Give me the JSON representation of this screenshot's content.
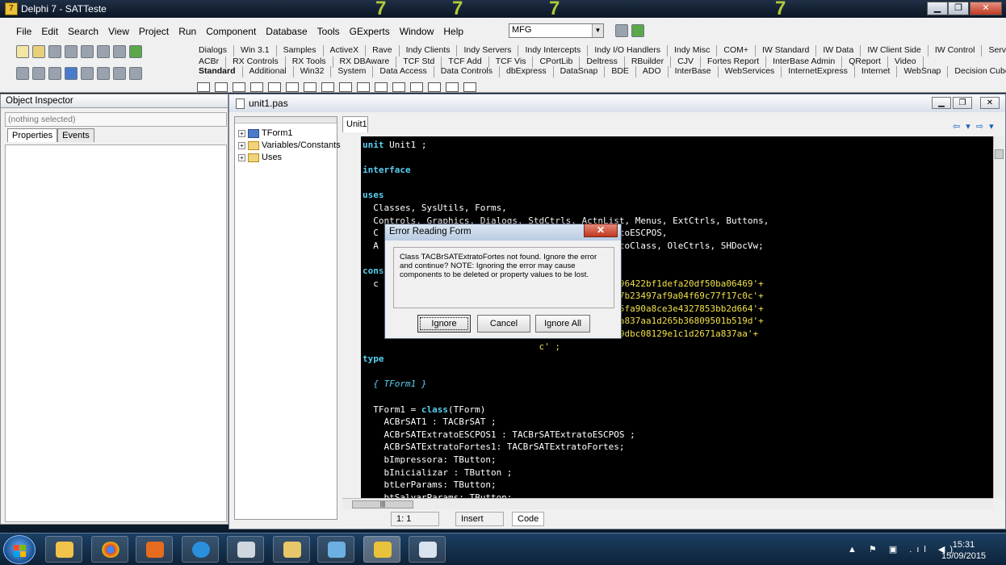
{
  "window": {
    "title": "Delphi 7 - SATTeste",
    "min": "▁",
    "max": "❐",
    "close": "✕"
  },
  "menu": [
    "File",
    "Edit",
    "Search",
    "View",
    "Project",
    "Run",
    "Component",
    "Database",
    "Tools",
    "GExperts",
    "Window",
    "Help"
  ],
  "desktop_combo": {
    "value": "MFG"
  },
  "palette": {
    "row1": [
      "Dialogs",
      "Win 3.1",
      "Samples",
      "ActiveX",
      "Rave",
      "Indy Clients",
      "Indy Servers",
      "Indy Intercepts",
      "Indy I/O Handlers",
      "Indy Misc",
      "COM+",
      "IW Standard",
      "IW Data",
      "IW Client Side",
      "IW Control",
      "Servers"
    ],
    "row2": [
      "ACBr",
      "RX Controls",
      "RX Tools",
      "RX DBAware",
      "TCF Std",
      "TCF Add",
      "TCF Vis",
      "CPortLib",
      "Deltress",
      "RBuilder",
      "CJV",
      "Fortes Report",
      "InterBase Admin",
      "QReport",
      "Video"
    ],
    "row3": [
      "Standard",
      "Additional",
      "Win32",
      "System",
      "Data Access",
      "Data Controls",
      "dbExpress",
      "DataSnap",
      "BDE",
      "ADO",
      "InterBase",
      "WebServices",
      "InternetExpress",
      "Internet",
      "WebSnap",
      "Decision Cube"
    ]
  },
  "object_inspector": {
    "title": "Object Inspector",
    "selection": "(nothing selected)",
    "tabs": [
      "Properties",
      "Events"
    ]
  },
  "editor": {
    "title": "unit1.pas",
    "tab": "Unit1",
    "tree": [
      "TForm1",
      "Variables/Constants",
      "Uses"
    ],
    "nav": "⇦ ▾ ⇨ ▾",
    "code": [
      [
        {
          "t": "unit ",
          "c": "kw"
        },
        {
          "t": "Unit1 ;",
          "c": "ident"
        }
      ],
      [],
      [
        {
          "t": "interface",
          "c": "kw"
        }
      ],
      [],
      [
        {
          "t": "uses",
          "c": "kw"
        }
      ],
      [
        {
          "t": "  Classes, SysUtils, Forms,",
          "c": "ident"
        }
      ],
      [
        {
          "t": "  Controls, Graphics, Dialogs, StdCtrls, ActnList, Menus, ExtCtrls, Buttons,",
          "c": "ident"
        }
      ],
      [
        {
          "t": "  C                                 ACBrSATExtratoESCPOS,",
          "c": "ident"
        }
      ],
      [
        {
          "t": "  A                                 ACBrSATExtratoClass, OleCtrls, SHDocVw;",
          "c": "ident"
        }
      ],
      [],
      [
        {
          "t": "cons",
          "c": "kw"
        }
      ],
      [
        {
          "t": "  c                                  ",
          "c": "ident"
        },
        {
          "t": "0719d526c5096422bf1defa20df50ba06469'+",
          "c": "hx"
        }
      ],
      [
        {
          "t": "                                     ",
          "c": "ident"
        },
        {
          "t": "6a5cc58496b7b23497af9a04f69c77f17c0c'+",
          "c": "hx"
        }
      ],
      [
        {
          "t": "                                     ",
          "c": "ident"
        },
        {
          "t": "8ca6f47aea05fa90a8ce3e4327853bb2d664'+",
          "c": "hx"
        }
      ],
      [
        {
          "t": "                                     ",
          "c": "ident"
        },
        {
          "t": "29e1c1d2671a837aa1d265b36809501b519d'+",
          "c": "hx"
        }
      ],
      [
        {
          "t": "                                     ",
          "c": "ident"
        },
        {
          "t": "36809501b519dbc08129e1c1d2671a837aa'+",
          "c": "hx"
        }
      ],
      [
        {
          "t": "                                 ",
          "c": "ident"
        },
        {
          "t": "c' ;",
          "c": "hx"
        }
      ],
      [
        {
          "t": "type",
          "c": "kw"
        }
      ],
      [],
      [
        {
          "t": "  { TForm1 }",
          "c": "cm"
        }
      ],
      [],
      [
        {
          "t": "  TForm1 = ",
          "c": "ident"
        },
        {
          "t": "class",
          "c": "kw"
        },
        {
          "t": "(TForm)",
          "c": "ident"
        }
      ],
      [
        {
          "t": "    ACBrSAT1 : TACBrSAT ;",
          "c": "ident"
        }
      ],
      [
        {
          "t": "    ACBrSATExtratoESCPOS1 : TACBrSATExtratoESCPOS ;",
          "c": "ident"
        }
      ],
      [
        {
          "t": "    ACBrSATExtratoFortes1: TACBrSATExtratoFortes;",
          "c": "ident"
        }
      ],
      [
        {
          "t": "    bImpressora: TButton;",
          "c": "ident"
        }
      ],
      [
        {
          "t": "    bInicializar : TButton ;",
          "c": "ident"
        }
      ],
      [
        {
          "t": "    btLerParams: TButton;",
          "c": "ident"
        }
      ],
      [
        {
          "t": "    btSalvarParams: TButton;",
          "c": "ident"
        }
      ]
    ],
    "status": {
      "pos": "1:   1",
      "mode": "Insert",
      "view": "Code"
    }
  },
  "dialog": {
    "title": "Error Reading Form",
    "message": "Class TACBrSATExtratoFortes not found.  Ignore the error and continue?  NOTE: Ignoring the error may cause components to be deleted or property values to be lost.",
    "buttons": [
      "Ignore",
      "Cancel",
      "Ignore All"
    ]
  },
  "taskbar": {
    "time": "15:31",
    "date": "15/09/2015",
    "tray": "▲ ⚑ ▣ .ıl ◀)"
  }
}
